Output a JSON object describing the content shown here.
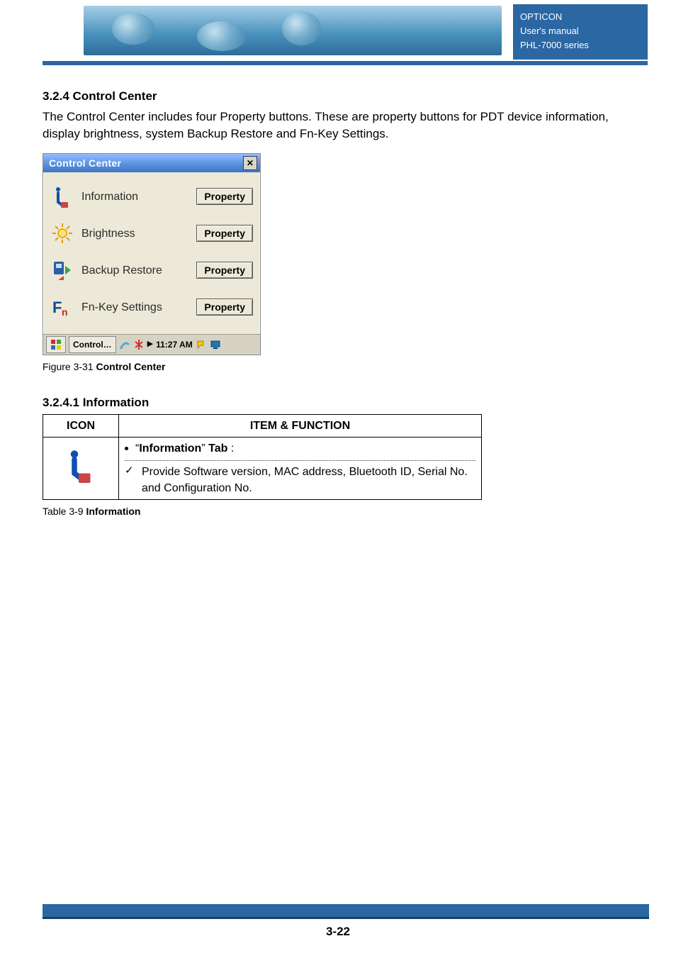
{
  "banner": {
    "right_lines": [
      "OPTICON",
      "User's manual",
      "PHL-7000 series"
    ]
  },
  "section": {
    "heading": "3.2.4 Control Center",
    "body": "The Control Center includes four Property buttons. These are property buttons for PDT device information, display brightness, system Backup Restore and Fn-Key Settings."
  },
  "control_center": {
    "window_title": "Control Center",
    "close_glyph": "✕",
    "rows": [
      {
        "icon_name": "info-icon",
        "label": "Information",
        "button": "Property"
      },
      {
        "icon_name": "brightness-icon",
        "label": "Brightness",
        "button": "Property"
      },
      {
        "icon_name": "backup-restore-icon",
        "label": "Backup Restore",
        "button": "Property"
      },
      {
        "icon_name": "fn-key-icon",
        "label": "Fn-Key Settings",
        "button": "Property"
      }
    ],
    "taskbar": {
      "app": "Control…",
      "time": "11:27 AM"
    }
  },
  "figure31": {
    "prefix": "Figure 3-31 ",
    "name": "Control Center"
  },
  "info_section": {
    "heading": "3.2.4.1 Information",
    "col_icon": "ICON",
    "col_item_function": "ITEM & FUNCTION",
    "tab_line": "\"Information\" Tab :",
    "desc": "Provide Software version, MAC address, Bluetooth ID, Serial No. and Configuration No."
  },
  "table39": {
    "prefix": "Table 3-9 ",
    "name": "Information"
  },
  "footer": {
    "page_no": "3-22"
  }
}
